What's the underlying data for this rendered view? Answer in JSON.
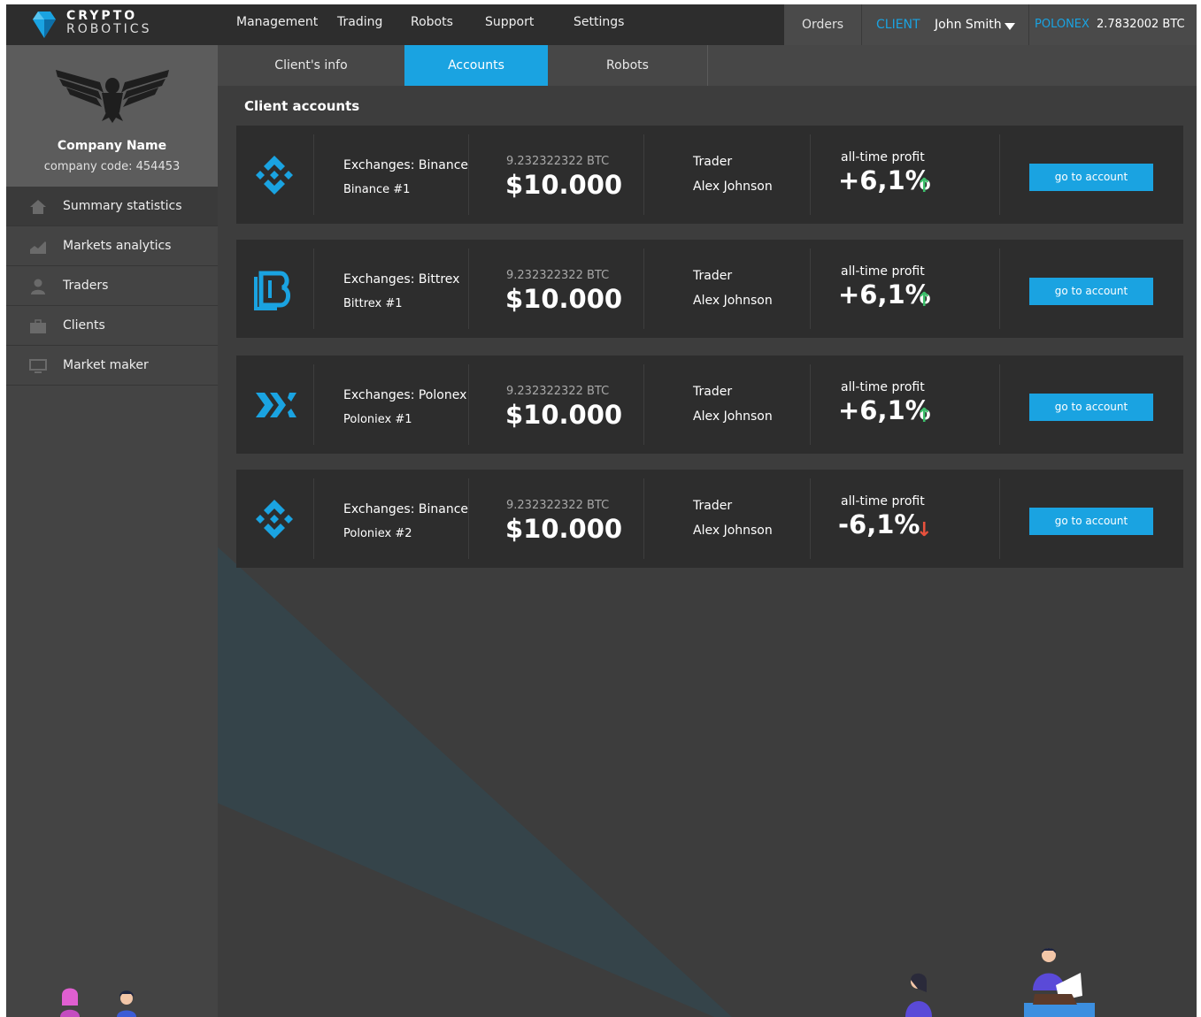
{
  "logo": {
    "line1": "CRYPTO",
    "line2": "ROBOTICS"
  },
  "nav": {
    "items": [
      {
        "label": "Management"
      },
      {
        "label": "Trading"
      },
      {
        "label": "Robots"
      },
      {
        "label": "Support"
      },
      {
        "label": "Settings"
      }
    ]
  },
  "topbar": {
    "orders_label": "Orders",
    "client_label": "CLIENT",
    "client_name": "John Smith",
    "exchange_label": "POLONEX",
    "exchange_balance": "2.7832002 BTC"
  },
  "company": {
    "name": "Company Name",
    "code": "company code: 454453"
  },
  "sidebar": {
    "items": [
      {
        "label": "Summary statistics",
        "icon": "home-icon"
      },
      {
        "label": "Markets analytics",
        "icon": "chart-icon"
      },
      {
        "label": "Traders",
        "icon": "user-icon"
      },
      {
        "label": "Clients",
        "icon": "briefcase-icon"
      },
      {
        "label": "Market maker",
        "icon": "monitor-icon"
      }
    ]
  },
  "subnav": {
    "tabs": [
      {
        "label": "Client's info"
      },
      {
        "label": "Accounts"
      },
      {
        "label": "Robots"
      }
    ]
  },
  "main": {
    "title": "Client accounts"
  },
  "accounts": [
    {
      "icon": "binance-logo-icon",
      "exchange": "Exchanges: Binance",
      "account": "Binance #1",
      "btc": "9.232322322 BTC",
      "usd": "$10.000",
      "trader_label": "Trader",
      "trader": "Alex Johnson",
      "profit_label": "all-time profit",
      "profit": "+6,1%",
      "trend": "up",
      "button": "go to account"
    },
    {
      "icon": "bittrex-logo-icon",
      "exchange": "Exchanges: Bittrex",
      "account": "Bittrex #1",
      "btc": "9.232322322 BTC",
      "usd": "$10.000",
      "trader_label": "Trader",
      "trader": "Alex Johnson",
      "profit_label": "all-time profit",
      "profit": "+6,1%",
      "trend": "up",
      "button": "go to account"
    },
    {
      "icon": "poloniex-logo-icon",
      "exchange": "Exchanges: Polonex",
      "account": "Poloniex #1",
      "btc": "9.232322322 BTC",
      "usd": "$10.000",
      "trader_label": "Trader",
      "trader": "Alex Johnson",
      "profit_label": "all-time profit",
      "profit": "+6,1%",
      "trend": "up",
      "button": "go to account"
    },
    {
      "icon": "binance-logo-icon",
      "exchange": "Exchanges: Binance",
      "account": "Poloniex #2",
      "btc": "9.232322322 BTC",
      "usd": "$10.000",
      "trader_label": "Trader",
      "trader": "Alex Johnson",
      "profit_label": "all-time profit",
      "profit": "-6,1%",
      "trend": "down",
      "button": "go to account"
    }
  ],
  "colors": {
    "accent": "#1aa3e1",
    "up": "#3cc06b",
    "down": "#e8513d"
  }
}
